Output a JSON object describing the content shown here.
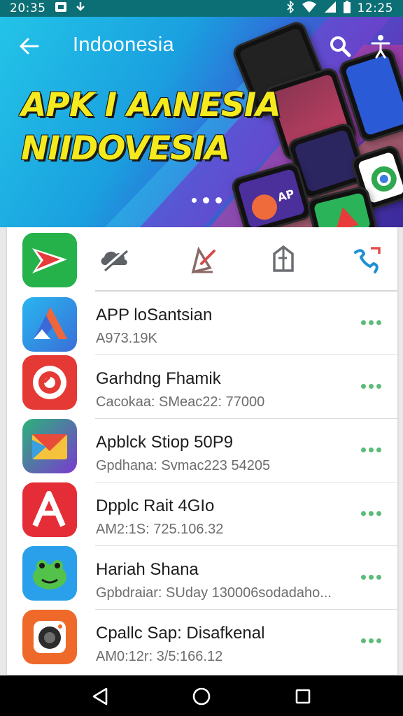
{
  "status_bar": {
    "time_left": "20:35",
    "time_right": "12:25"
  },
  "header": {
    "title": "Indoonesia"
  },
  "banner": {
    "line1": "APK I AʌNESIA",
    "line2": "NIIDOVESIA",
    "app_badge_text": "AP"
  },
  "colors": {
    "status_bar": "#0b6f75",
    "headline_yellow": "#f5ea1d",
    "menu_dots_green": "#5cbb78"
  },
  "quick_actions": [
    {
      "icon": "cloud-off-icon"
    },
    {
      "icon": "edit-icon"
    },
    {
      "icon": "archive-icon"
    },
    {
      "icon": "call-icon"
    }
  ],
  "apps": [
    {
      "title": "APP loSantsian",
      "subtitle": "A973.19K",
      "icon": "triangle-app-icon"
    },
    {
      "title": "Garhdng Fhamik",
      "subtitle": "Cacokaa:   SMeac22: 77000",
      "icon": "gear-app-icon"
    },
    {
      "title": "Apblck Stiop 50P9",
      "subtitle": "Gpdhana:   Svmac223 54205",
      "icon": "mail-app-icon"
    },
    {
      "title": "Dpplc Rait 4GIo",
      "subtitle": "AM2:1S:   725.106.32",
      "icon": "letter-a-app-icon"
    },
    {
      "title": "Hariah Shana",
      "subtitle": "Gpbdraiar:   SUday 130006sodadaho...",
      "icon": "frog-app-icon"
    },
    {
      "title": "Cpallc Sap: Disafkenal",
      "subtitle": "AM0:12r:   3/5:166.12",
      "icon": "camera-app-icon"
    }
  ]
}
